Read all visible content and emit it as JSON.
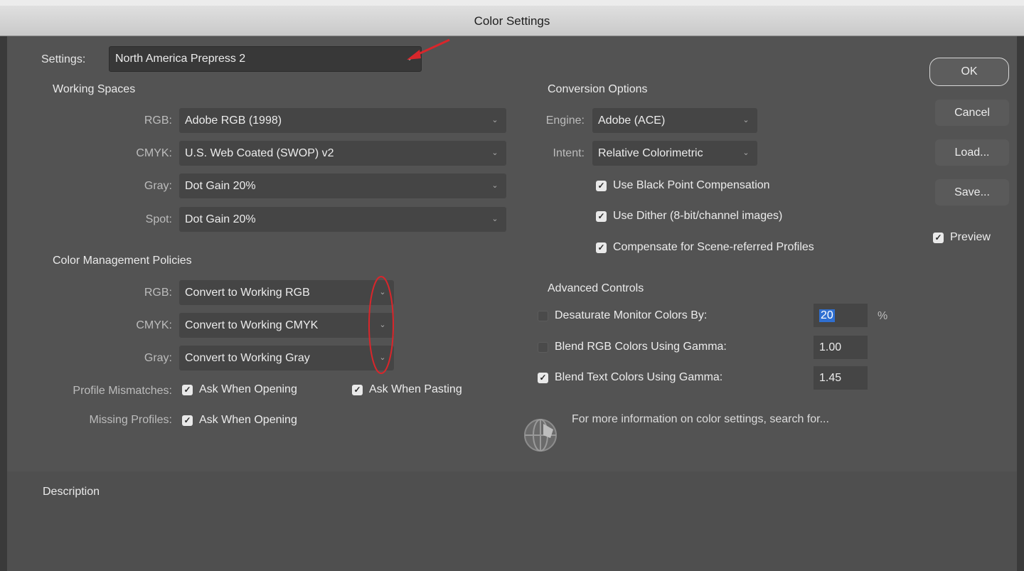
{
  "window": {
    "title": "Color Settings"
  },
  "settings": {
    "label": "Settings:",
    "value": "North America Prepress 2"
  },
  "working_spaces": {
    "heading": "Working Spaces",
    "rows": [
      {
        "label": "RGB:",
        "value": "Adobe RGB (1998)"
      },
      {
        "label": "CMYK:",
        "value": "U.S. Web Coated (SWOP) v2"
      },
      {
        "label": "Gray:",
        "value": "Dot Gain 20%"
      },
      {
        "label": "Spot:",
        "value": "Dot Gain 20%"
      }
    ]
  },
  "policies": {
    "heading": "Color Management Policies",
    "rows": [
      {
        "label": "RGB:",
        "value": "Convert to Working RGB"
      },
      {
        "label": "CMYK:",
        "value": "Convert to Working CMYK"
      },
      {
        "label": "Gray:",
        "value": "Convert to Working Gray"
      }
    ],
    "profile_mismatches": {
      "label": "Profile Mismatches:",
      "ask_opening": {
        "label": "Ask When Opening",
        "checked": true
      },
      "ask_pasting": {
        "label": "Ask When Pasting",
        "checked": true
      }
    },
    "missing_profiles": {
      "label": "Missing Profiles:",
      "ask_opening": {
        "label": "Ask When Opening",
        "checked": true
      }
    }
  },
  "conversion": {
    "heading": "Conversion Options",
    "engine": {
      "label": "Engine:",
      "value": "Adobe (ACE)"
    },
    "intent": {
      "label": "Intent:",
      "value": "Relative Colorimetric"
    },
    "black_point": {
      "label": "Use Black Point Compensation",
      "checked": true
    },
    "dither": {
      "label": "Use Dither (8-bit/channel images)",
      "checked": true
    },
    "scene_referred": {
      "label": "Compensate for Scene-referred Profiles",
      "checked": true
    }
  },
  "advanced": {
    "heading": "Advanced Controls",
    "desaturate": {
      "label": "Desaturate Monitor Colors By:",
      "value": "20",
      "unit": "%",
      "checked": false
    },
    "blend_rgb": {
      "label": "Blend RGB Colors Using Gamma:",
      "value": "1.00",
      "checked": false
    },
    "blend_text": {
      "label": "Blend Text Colors Using Gamma:",
      "value": "1.45",
      "checked": true
    }
  },
  "info": {
    "text": "For more information on color settings, search for..."
  },
  "description": {
    "heading": "Description"
  },
  "buttons": {
    "ok": "OK",
    "cancel": "Cancel",
    "load": "Load...",
    "save": "Save..."
  },
  "preview": {
    "label": "Preview",
    "checked": true
  },
  "icons": {
    "chevron": "chevron-down-icon",
    "check": "checkmark-icon",
    "globe": "globe-icon"
  },
  "colors": {
    "dialog_bg": "#535353",
    "annotation_red": "#d9262b",
    "selection_blue": "#2f6fd1"
  }
}
